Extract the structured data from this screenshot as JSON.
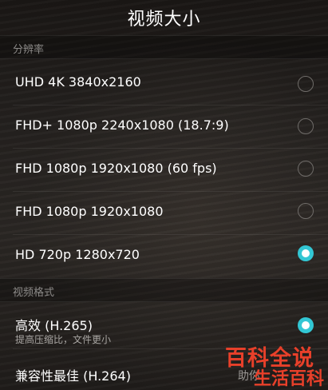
{
  "header": {
    "title": "视频大小"
  },
  "resolution": {
    "section_label": "分辨率",
    "options": [
      {
        "label": "UHD 4K 3840x2160",
        "selected": false
      },
      {
        "label": "FHD+ 1080p 2240x1080 (18.7:9)",
        "selected": false
      },
      {
        "label": "FHD 1080p 1920x1080 (60 fps)",
        "selected": false
      },
      {
        "label": "FHD 1080p 1920x1080",
        "selected": false
      },
      {
        "label": "HD 720p 1280x720",
        "selected": true
      }
    ]
  },
  "format": {
    "section_label": "视频格式",
    "options": [
      {
        "label": "高效 (H.265)",
        "sublabel": "提高压缩比，文件更小",
        "selected": true
      },
      {
        "label": "兼容性最佳 (H.264)",
        "sublabel": "助你",
        "selected": false
      }
    ]
  },
  "watermark": {
    "line1": "百科全说",
    "line2": "生活百科"
  },
  "colors": {
    "accent": "#33c7d4",
    "watermark": "#e8402a"
  }
}
